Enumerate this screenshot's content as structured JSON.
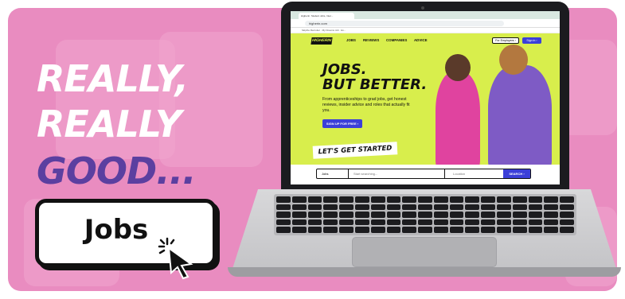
{
  "colors": {
    "banner_bg": "#e98cc0",
    "headline_white": "#ffffff",
    "headline_purple": "#5b3fa0",
    "site_lime": "#d8ee4c",
    "site_blue": "#3b3fd8"
  },
  "headline": {
    "line1": "REALLY,",
    "line2": "REALLY",
    "line3": "GOOD..."
  },
  "cta": {
    "label": "Jobs"
  },
  "browser": {
    "tab_title": "Higherin: Student Jobs, Inter...",
    "url": "higherin.com",
    "bookmarks": "Skipthe Recruiter · My Dreams Job · Ex..."
  },
  "site": {
    "logo": "HIGHERIN",
    "nav": [
      "JOBS",
      "REVIEWS",
      "COMPANIES",
      "ADVICE"
    ],
    "for_employers": "For Employers ›",
    "sign_in": "Sign in ›",
    "hero_title_1": "JOBS.",
    "hero_title_2": "BUT BETTER.",
    "hero_text": "From apprenticeships to grad jobs, get honest reviews, insider advice and roles that actually fit you.",
    "signup": "SIGN UP FOR FREE ›",
    "get_started": "LET'S GET STARTED",
    "search": {
      "select": "Jobs",
      "placeholder": "Start searching...",
      "location": "Location",
      "button": "SEARCH ›"
    }
  }
}
